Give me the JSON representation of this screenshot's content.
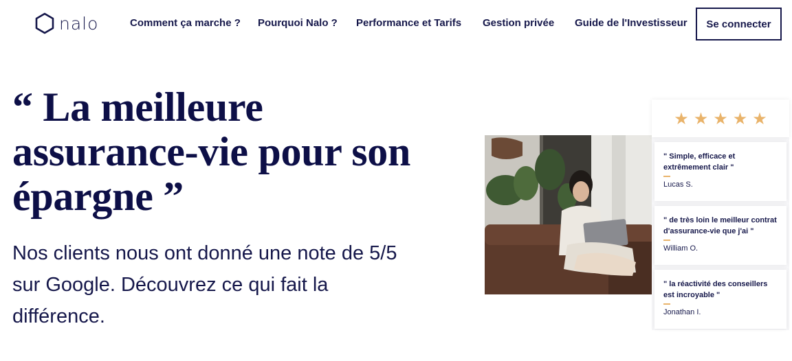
{
  "brand": {
    "name": "nalo"
  },
  "nav": {
    "items": [
      {
        "label": "Comment ça marche ?"
      },
      {
        "label": "Pourquoi Nalo ?"
      },
      {
        "label": "Performance et Tarifs"
      },
      {
        "label": "Gestion privée"
      },
      {
        "label": "Guide de l'Investisseur"
      }
    ],
    "login_label": "Se connecter"
  },
  "hero": {
    "headline": "“ La meilleure assurance-vie pour son épargne ”",
    "subline": "Nos clients nous ont donné une note de 5/5 sur Google. Découvrez ce qui fait la différence."
  },
  "rating": {
    "stars": 5,
    "max": 5
  },
  "reviews": [
    {
      "quote": "\" Simple, efficace et extrêmement clair \"",
      "author": "Lucas S."
    },
    {
      "quote": "\" de très loin le meilleur contrat d'assurance-vie que j'ai \"",
      "author": "William O."
    },
    {
      "quote": "\" la réactivité des conseillers est incroyable \"",
      "author": "Jonathan I."
    }
  ],
  "colors": {
    "navy": "#15174a",
    "star": "#e9b36a"
  }
}
